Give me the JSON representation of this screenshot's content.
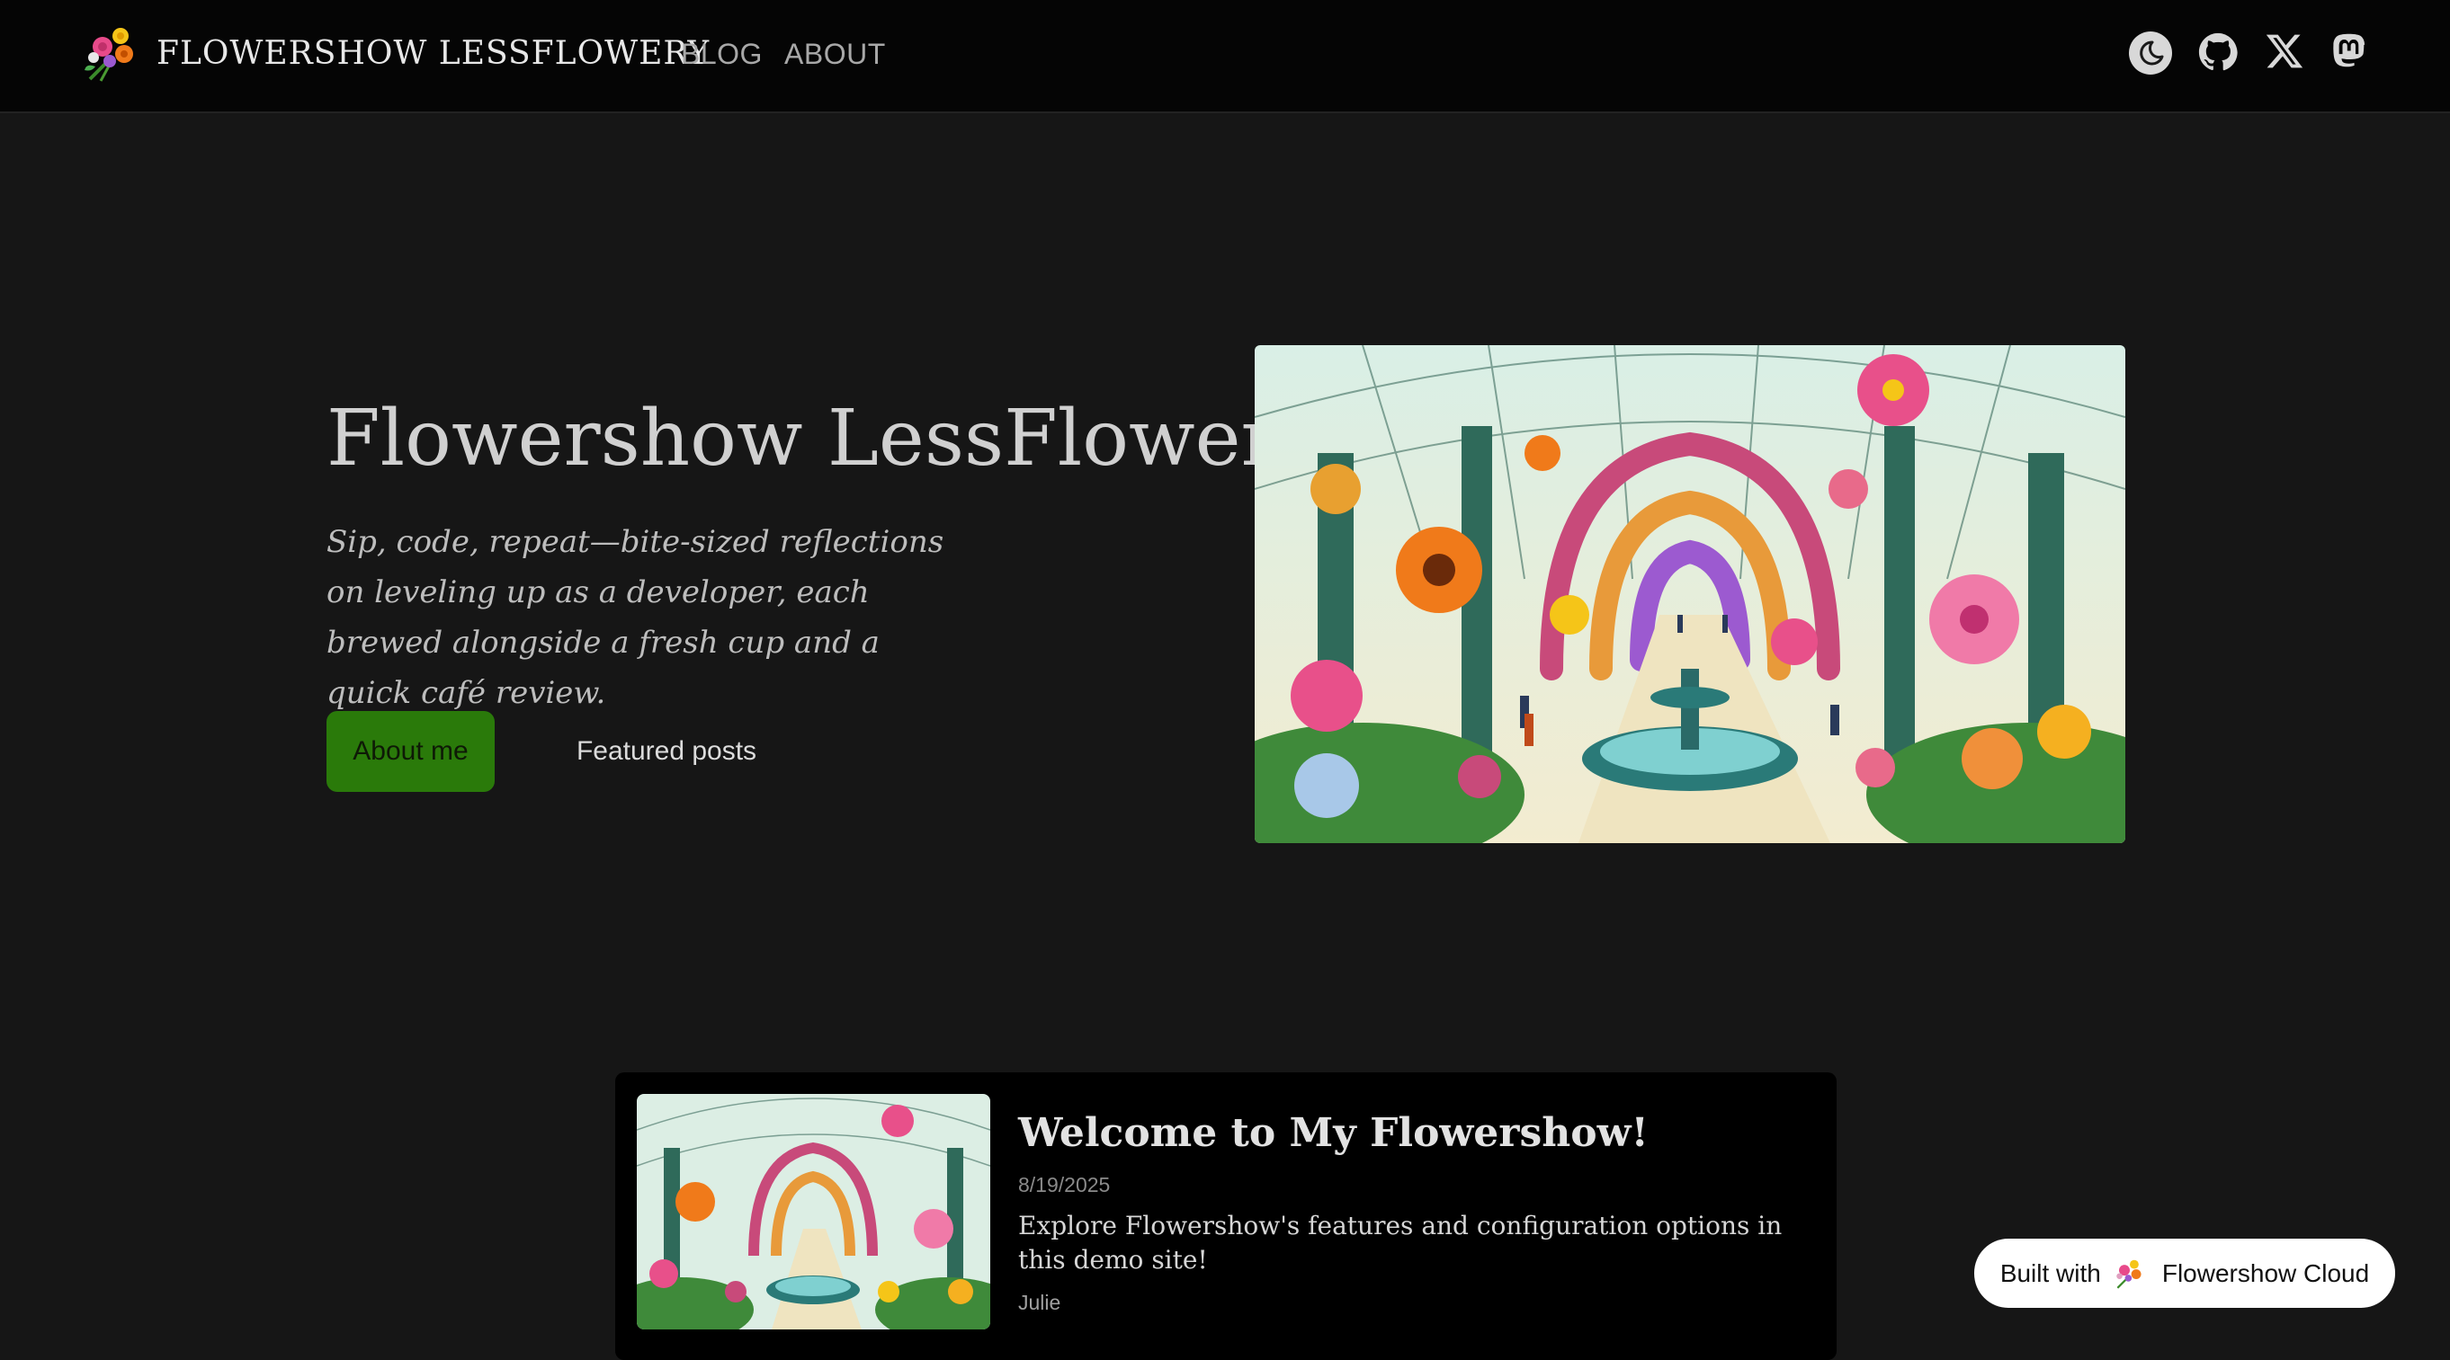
{
  "header": {
    "brand_name": "FLOWERSHOW LESSFLOWERY",
    "nav": [
      {
        "label": "BLOG"
      },
      {
        "label": "ABOUT"
      }
    ],
    "icons": [
      "theme-toggle-moon-icon",
      "github-icon",
      "x-icon",
      "mastodon-icon"
    ]
  },
  "hero": {
    "title": "Flowershow LessFlowery",
    "subtitle": "Sip, code, repeat—bite-sized reflections on leveling up as a developer, each brewed alongside a fresh cup and a quick café review.",
    "primary_button": "About me",
    "secondary_button": "Featured posts"
  },
  "posts": [
    {
      "title": "Welcome to My Flowershow!",
      "date": "8/19/2025",
      "description": "Explore Flowershow's features and configuration options in this demo site!",
      "author": "Julie"
    }
  ],
  "badge": {
    "prefix": "Built with",
    "name": "Flowershow Cloud"
  },
  "colors": {
    "background": "#161616",
    "header": "#050505",
    "accent_button": "#2a7a0a",
    "card": "#000000"
  }
}
